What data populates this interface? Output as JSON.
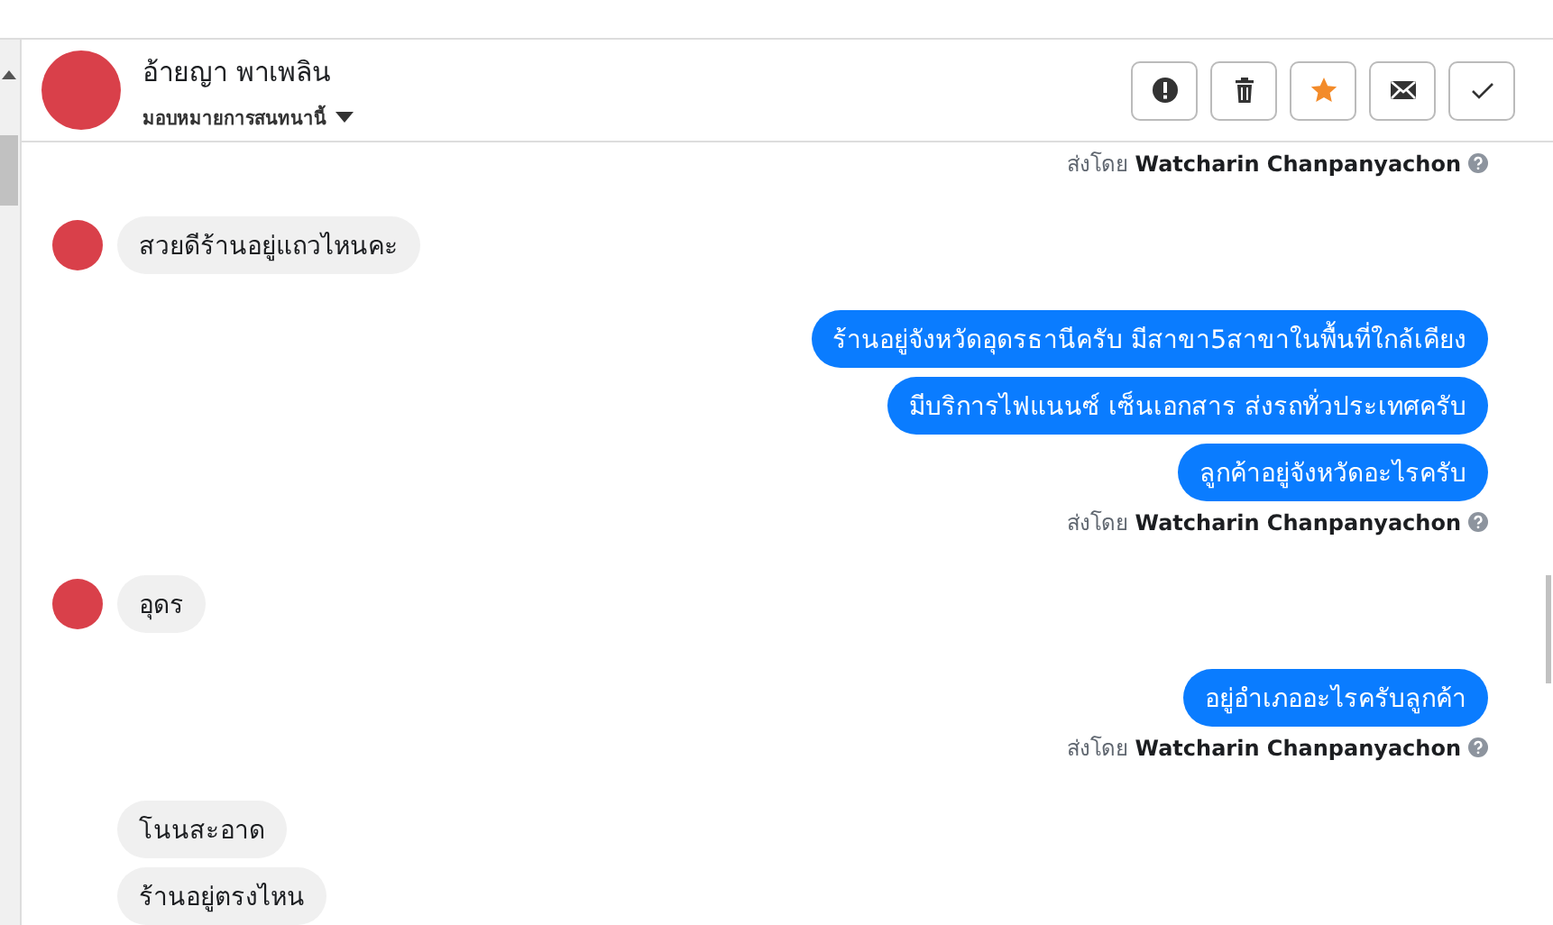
{
  "header": {
    "name": "อ้ายญา พาเพลิน",
    "assign_label": "มอบหมายการสนทนานี้"
  },
  "actions": [
    {
      "kind": "report",
      "on": false
    },
    {
      "kind": "delete",
      "on": false
    },
    {
      "kind": "star",
      "on": true
    },
    {
      "kind": "unread",
      "on": false
    },
    {
      "kind": "done",
      "on": false
    }
  ],
  "messages": [
    {
      "kind": "meta",
      "text": "ส่งโดย **Watcharin Chanpanyachon**"
    },
    {
      "kind": "received",
      "avatar": true,
      "text": "สวยดีร้านอยู่แถวไหนคะ"
    },
    {
      "kind": "sent",
      "text": "ร้านอยู่จังหวัดอุดรธานีครับ มีสาขา5สาขาในพื้นที่ใกล้เคียง"
    },
    {
      "kind": "sent",
      "text": "มีบริการไฟแนนซ์ เซ็นเอกสาร ส่งรถทั่วประเทศครับ"
    },
    {
      "kind": "sent",
      "text": "ลูกค้าอยู่จังหวัดอะไรครับ"
    },
    {
      "kind": "meta",
      "text": "ส่งโดย **Watcharin Chanpanyachon**"
    },
    {
      "kind": "received",
      "avatar": true,
      "text": "อุดร"
    },
    {
      "kind": "sent",
      "text": "อยู่อำเภออะไรครับลูกค้า"
    },
    {
      "kind": "meta",
      "text": "ส่งโดย **Watcharin Chanpanyachon**"
    },
    {
      "kind": "received",
      "avatar": false,
      "text": "โนนสะอาด"
    },
    {
      "kind": "received",
      "avatar": false,
      "text": "ร้านอยู่ตรงไหน"
    }
  ]
}
